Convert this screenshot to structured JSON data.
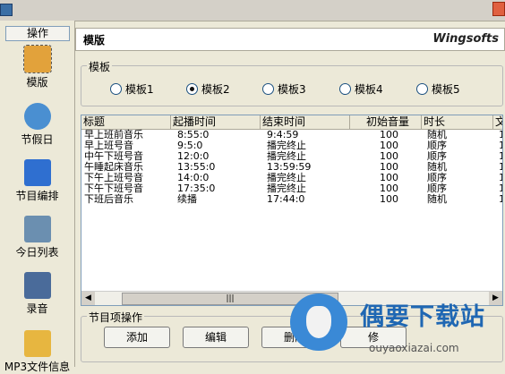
{
  "left_panel": {
    "header": "操作",
    "items": [
      {
        "label": "模版",
        "icon": "template-icon",
        "color": "#e2a23b",
        "selected": true
      },
      {
        "label": "节假日",
        "icon": "clock-icon",
        "color": "#4a8fd1"
      },
      {
        "label": "节目编排",
        "icon": "edit-icon",
        "color": "#2f6fd0"
      },
      {
        "label": "今日列表",
        "icon": "search-list-icon",
        "color": "#6b8fb0"
      },
      {
        "label": "录音",
        "icon": "music-note-icon",
        "color": "#4a6b9a"
      },
      {
        "label": "MP3文件信息",
        "icon": "folder-icon",
        "color": "#e7b640"
      }
    ]
  },
  "header": {
    "title": "模版",
    "brand": "Wingsofts"
  },
  "template_group": {
    "legend": "模板",
    "options": [
      "模板1",
      "模板2",
      "模板3",
      "模板4",
      "模板5"
    ],
    "selected_index": 1
  },
  "table": {
    "columns": [
      "标题",
      "起播时间",
      "结束时间",
      "初始音量",
      "时长",
      "文"
    ],
    "rows": [
      [
        "早上班前音乐",
        "8:55:0",
        "9:4:59",
        "100",
        "随机",
        "1"
      ],
      [
        "早上班号音",
        "9:5:0",
        "播完终止",
        "100",
        "顺序",
        "1"
      ],
      [
        "中午下班号音",
        "12:0:0",
        "播完终止",
        "100",
        "顺序",
        "1"
      ],
      [
        "午睡起床音乐",
        "13:55:0",
        "13:59:59",
        "100",
        "随机",
        "1"
      ],
      [
        "下午上班号音",
        "14:0:0",
        "播完终止",
        "100",
        "顺序",
        "1"
      ],
      [
        "下午下班号音",
        "17:35:0",
        "播完终止",
        "100",
        "顺序",
        "1"
      ],
      [
        "下班后音乐",
        "续播",
        "17:44:0",
        "100",
        "随机",
        "1"
      ]
    ]
  },
  "actions": {
    "legend": "节目项操作",
    "add": "添加",
    "edit": "编辑",
    "delete": "删除",
    "partial": "修"
  },
  "watermark": {
    "text": "偶要下载站",
    "url": "ouyaoxiazai.com"
  }
}
